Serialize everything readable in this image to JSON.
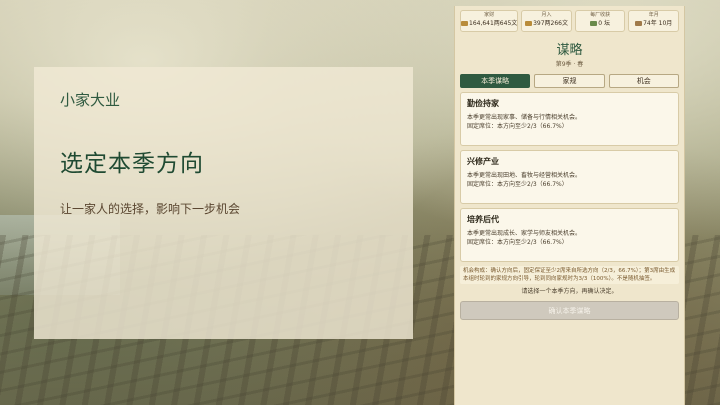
{
  "intro": {
    "kicker": "小家大业",
    "title": "选定本季方向",
    "subtitle": "让一家人的选择，影响下一步机会"
  },
  "stats": [
    {
      "label": "家财",
      "value": "164,641两645文",
      "icon": "coin-icon"
    },
    {
      "label": "月入",
      "value": "397两266文",
      "icon": "coin-icon"
    },
    {
      "label": "每厂收获",
      "value": "0 坛",
      "icon": "jar-icon"
    },
    {
      "label": "年月",
      "value": "74年 10月",
      "icon": "calendar-icon"
    }
  ],
  "panel": {
    "heading": "谋略",
    "season": "第9季 · 春",
    "tabs": [
      "本季谋略",
      "家规",
      "机会"
    ],
    "options": [
      {
        "title": "勤俭持家",
        "desc": "本季更常出现家事、储备与行情相关机会。",
        "fixed": "固定席位：本方向至少2/3（66.7%）"
      },
      {
        "title": "兴修产业",
        "desc": "本季更常出现田地、畜牧与经营相关机会。",
        "fixed": "固定席位：本方向至少2/3（66.7%）"
      },
      {
        "title": "培养后代",
        "desc": "本季更常出现成长、家学与师友相关机会。",
        "fixed": "固定席位：本方向至少2/3（66.7%）"
      }
    ],
    "note": "机会构成：确认方向后，固定保证至少2席来自所选方向（2/3，66.7%）；第3席由生成本组时轮到的家规方向引导，轮到同向家规时为3/3（100%）。不是随机抽签。",
    "prompt": "请选择一个本季方向，再确认决定。",
    "confirm_label": "确认本季谋略"
  }
}
